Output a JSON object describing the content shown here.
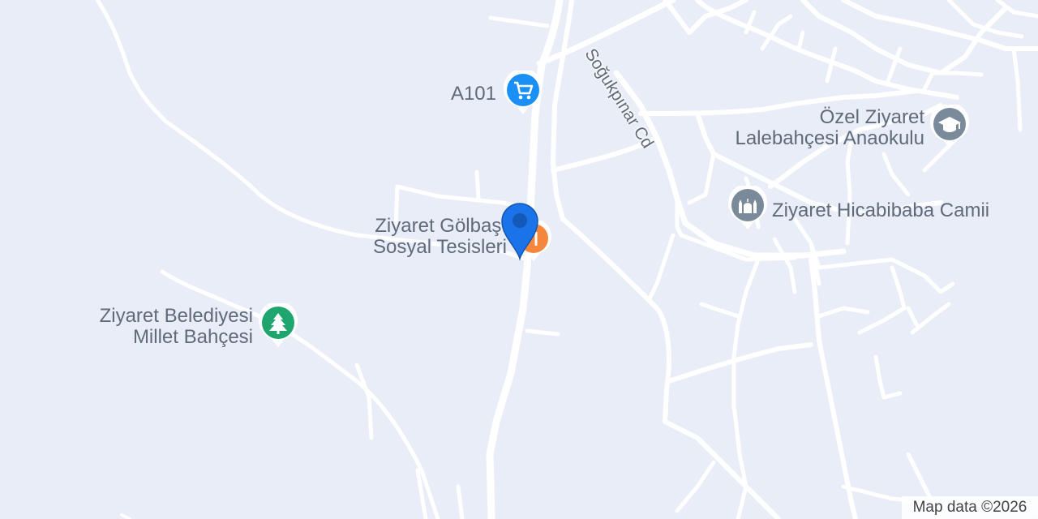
{
  "colors": {
    "background": "#e9edf7",
    "road": "#ffffff",
    "label": "#5f6b7a",
    "shopping_pin": "#1a8ff5",
    "education_pin": "#7b8a9b",
    "worship_pin": "#7b8a9b",
    "park_pin": "#1fa66e",
    "food_pin": "#f4873b",
    "location_pin": "#1a73e8"
  },
  "streets": [
    {
      "name": "Soğukpınar Cd"
    }
  ],
  "pois": [
    {
      "name": "A101",
      "icon": "shopping-cart-icon",
      "category": "shopping"
    },
    {
      "name_lines": [
        "Özel Ziyaret",
        "Lalebahçesi Anaokulu"
      ],
      "icon": "graduation-cap-icon",
      "category": "education"
    },
    {
      "name": "Ziyaret Hicabibaba Camii",
      "icon": "mosque-icon",
      "category": "place-of-worship"
    },
    {
      "name_lines": [
        "Ziyaret Gölbaşı",
        "Sosyal Tesisleri"
      ],
      "icon": "restaurant-icon",
      "category": "food"
    },
    {
      "name_lines": [
        "Ziyaret Belediyesi",
        "Millet Bahçesi"
      ],
      "icon": "tree-icon",
      "category": "park"
    }
  ],
  "selected_marker": {
    "icon": "location-pin-icon"
  },
  "attribution": "Map data ©2026"
}
